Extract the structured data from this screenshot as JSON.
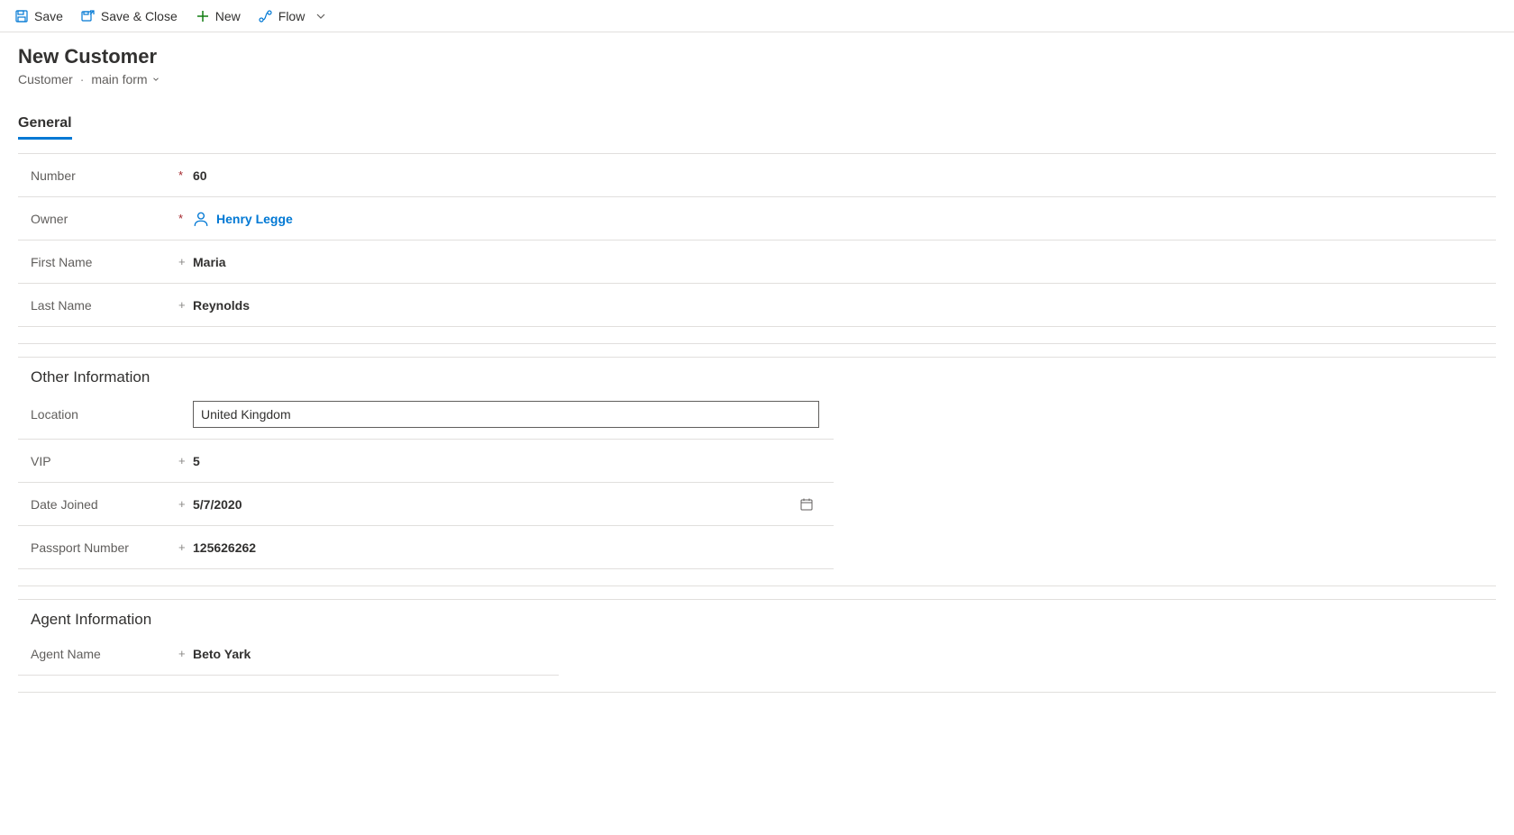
{
  "toolbar": {
    "save": "Save",
    "saveClose": "Save & Close",
    "new": "New",
    "flow": "Flow"
  },
  "header": {
    "title": "New Customer",
    "entity": "Customer",
    "form": "main form"
  },
  "tabs": {
    "general": "General"
  },
  "generalSection": {
    "number": {
      "label": "Number",
      "value": "60"
    },
    "owner": {
      "label": "Owner",
      "value": "Henry Legge"
    },
    "firstName": {
      "label": "First Name",
      "value": "Maria"
    },
    "lastName": {
      "label": "Last Name",
      "value": "Reynolds"
    }
  },
  "otherSection": {
    "title": "Other Information",
    "location": {
      "label": "Location",
      "value": "United Kingdom"
    },
    "vip": {
      "label": "VIP",
      "value": "5"
    },
    "dateJoined": {
      "label": "Date Joined",
      "value": "5/7/2020"
    },
    "passport": {
      "label": "Passport Number",
      "value": "125626262"
    }
  },
  "agentSection": {
    "title": "Agent Information",
    "agentName": {
      "label": "Agent Name",
      "value": "Beto Yark"
    }
  }
}
